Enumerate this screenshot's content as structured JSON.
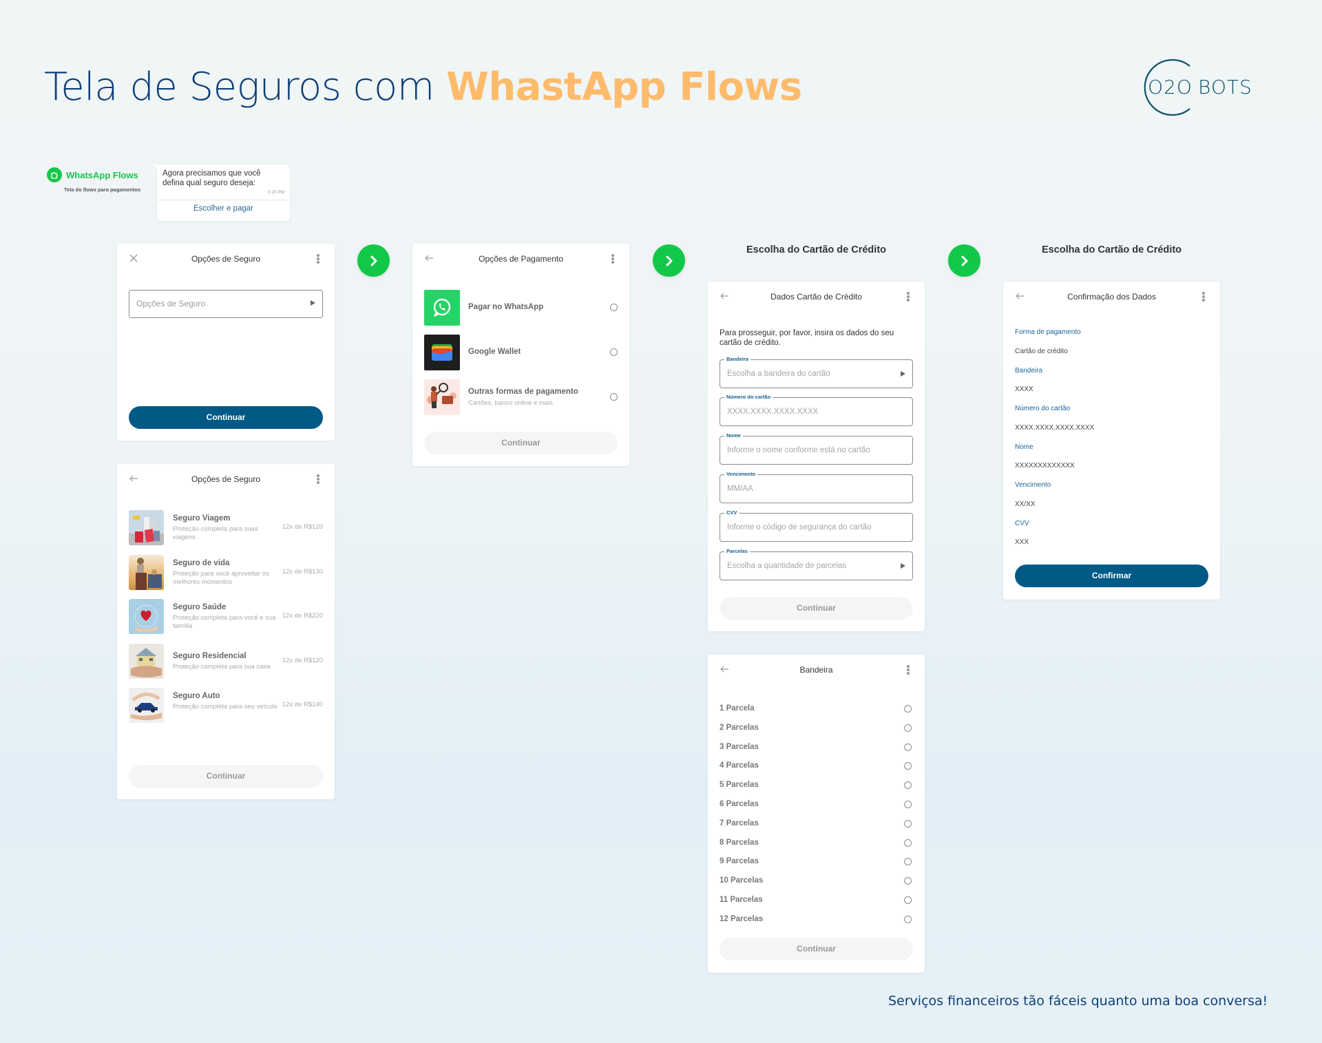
{
  "header": {
    "title_main": "Tela de Seguros com ",
    "title_accent": "WhastApp Flows",
    "logo_text_left": "O2O",
    "logo_text_right": "BOTS"
  },
  "colors": {
    "navy": "#0f3f77",
    "accent_orange": "#fdbb6b",
    "whatsapp_green": "#12c848",
    "primary_button": "#015a86",
    "label_blue": "#16608f"
  },
  "badge": {
    "title": "WhatsApp Flows",
    "subtitle": "Tela do flows para pagamentos",
    "icon": "puzzle-icon"
  },
  "chat": {
    "message": "Agora precisamos que você defina qual seguro deseja:",
    "time": "0:20 PM",
    "action": "Escolher e pagar"
  },
  "screen_seguro_select": {
    "title": "Opções de Seguro",
    "close_icon": "close-icon",
    "select_placeholder": "Opções de Seguro",
    "button": "Continuar"
  },
  "screen_seguro_list": {
    "title": "Opções de Seguro",
    "items": [
      {
        "name": "Seguro Viagem",
        "desc": "Proteção completa para suas viagens",
        "price": "12x de R$120",
        "image": "travel-photo"
      },
      {
        "name": "Seguro de vida",
        "desc": "Proteção para você aproveitar os melhores momentos",
        "price": "12x de R$130",
        "image": "family-photo"
      },
      {
        "name": "Seguro Saúde",
        "desc": "Proteção completa para você e sua família",
        "price": "12x de R$220",
        "image": "health-photo"
      },
      {
        "name": "Seguro Residencial",
        "desc": "Proteção completa para sua casa",
        "price": "12x de R$120",
        "image": "house-photo"
      },
      {
        "name": "Seguro Auto",
        "desc": "Proteção completa para seu veículo",
        "price": "12x de R$140",
        "image": "car-photo"
      }
    ],
    "button": "Continuar"
  },
  "screen_pagamento": {
    "title": "Opções de Pagamento",
    "items": [
      {
        "name": "Pagar no WhatsApp",
        "sub": "",
        "icon": "whatsapp-icon"
      },
      {
        "name": "Google Wallet",
        "sub": "",
        "icon": "google-wallet-icon"
      },
      {
        "name": "Outras formas de pagamento",
        "sub": "Cartões, banco online e mais",
        "icon": "payment-illustration"
      }
    ],
    "button": "Continuar"
  },
  "section_titles": {
    "cartao_1": "Escolha do Cartão de Crédito",
    "cartao_2": "Escolha do Cartão de Crédito"
  },
  "screen_dados_cartao": {
    "title": "Dados Cartão de Crédito",
    "intro": "Para prosseguir, por favor, insira os dados do seu cartão de crédito.",
    "fields": [
      {
        "label": "Bandeira",
        "placeholder": "Escolha a bandeira do cartão",
        "dropdown": true
      },
      {
        "label": "Número do cartão",
        "placeholder": "XXXX.XXXX.XXXX.XXXX",
        "dropdown": false
      },
      {
        "label": "Nome",
        "placeholder": "Informe o nome conforme está no cartão",
        "dropdown": false
      },
      {
        "label": "Vencimento",
        "placeholder": "MM/AA",
        "dropdown": false
      },
      {
        "label": "CVV",
        "placeholder": "Informe o código de segurança do cartão",
        "dropdown": false
      },
      {
        "label": "Parcelas",
        "placeholder": "Escolha a quantidade de parcelas",
        "dropdown": true
      }
    ],
    "button": "Continuar"
  },
  "screen_bandeira": {
    "title": "Bandeira",
    "options": [
      "1 Parcela",
      "2 Parcelas",
      "3 Parcelas",
      "4 Parcelas",
      "5 Parcelas",
      "6 Parcelas",
      "7 Parcelas",
      "8 Parcelas",
      "9 Parcelas",
      "10 Parcelas",
      "11 Parcelas",
      "12 Parcelas"
    ],
    "button": "Continuar"
  },
  "screen_confirmacao": {
    "title": "Confirmação dos Dados",
    "rows": [
      {
        "label": "Forma de pagamento",
        "value": "Cartão de crédito"
      },
      {
        "label": "Bandeira",
        "value": "XXXX"
      },
      {
        "label": "Número do cartão",
        "value": "XXXX.XXXX.XXXX.XXXX"
      },
      {
        "label": "Nome",
        "value": "XXXXXXXXXXXXX"
      },
      {
        "label": "Vencimento",
        "value": "XX/XX"
      },
      {
        "label": "CVV",
        "value": "XXX"
      }
    ],
    "button": "Confirmar"
  },
  "footer": {
    "tagline": "Serviços financeiros tão fáceis  quanto uma boa conversa!"
  }
}
